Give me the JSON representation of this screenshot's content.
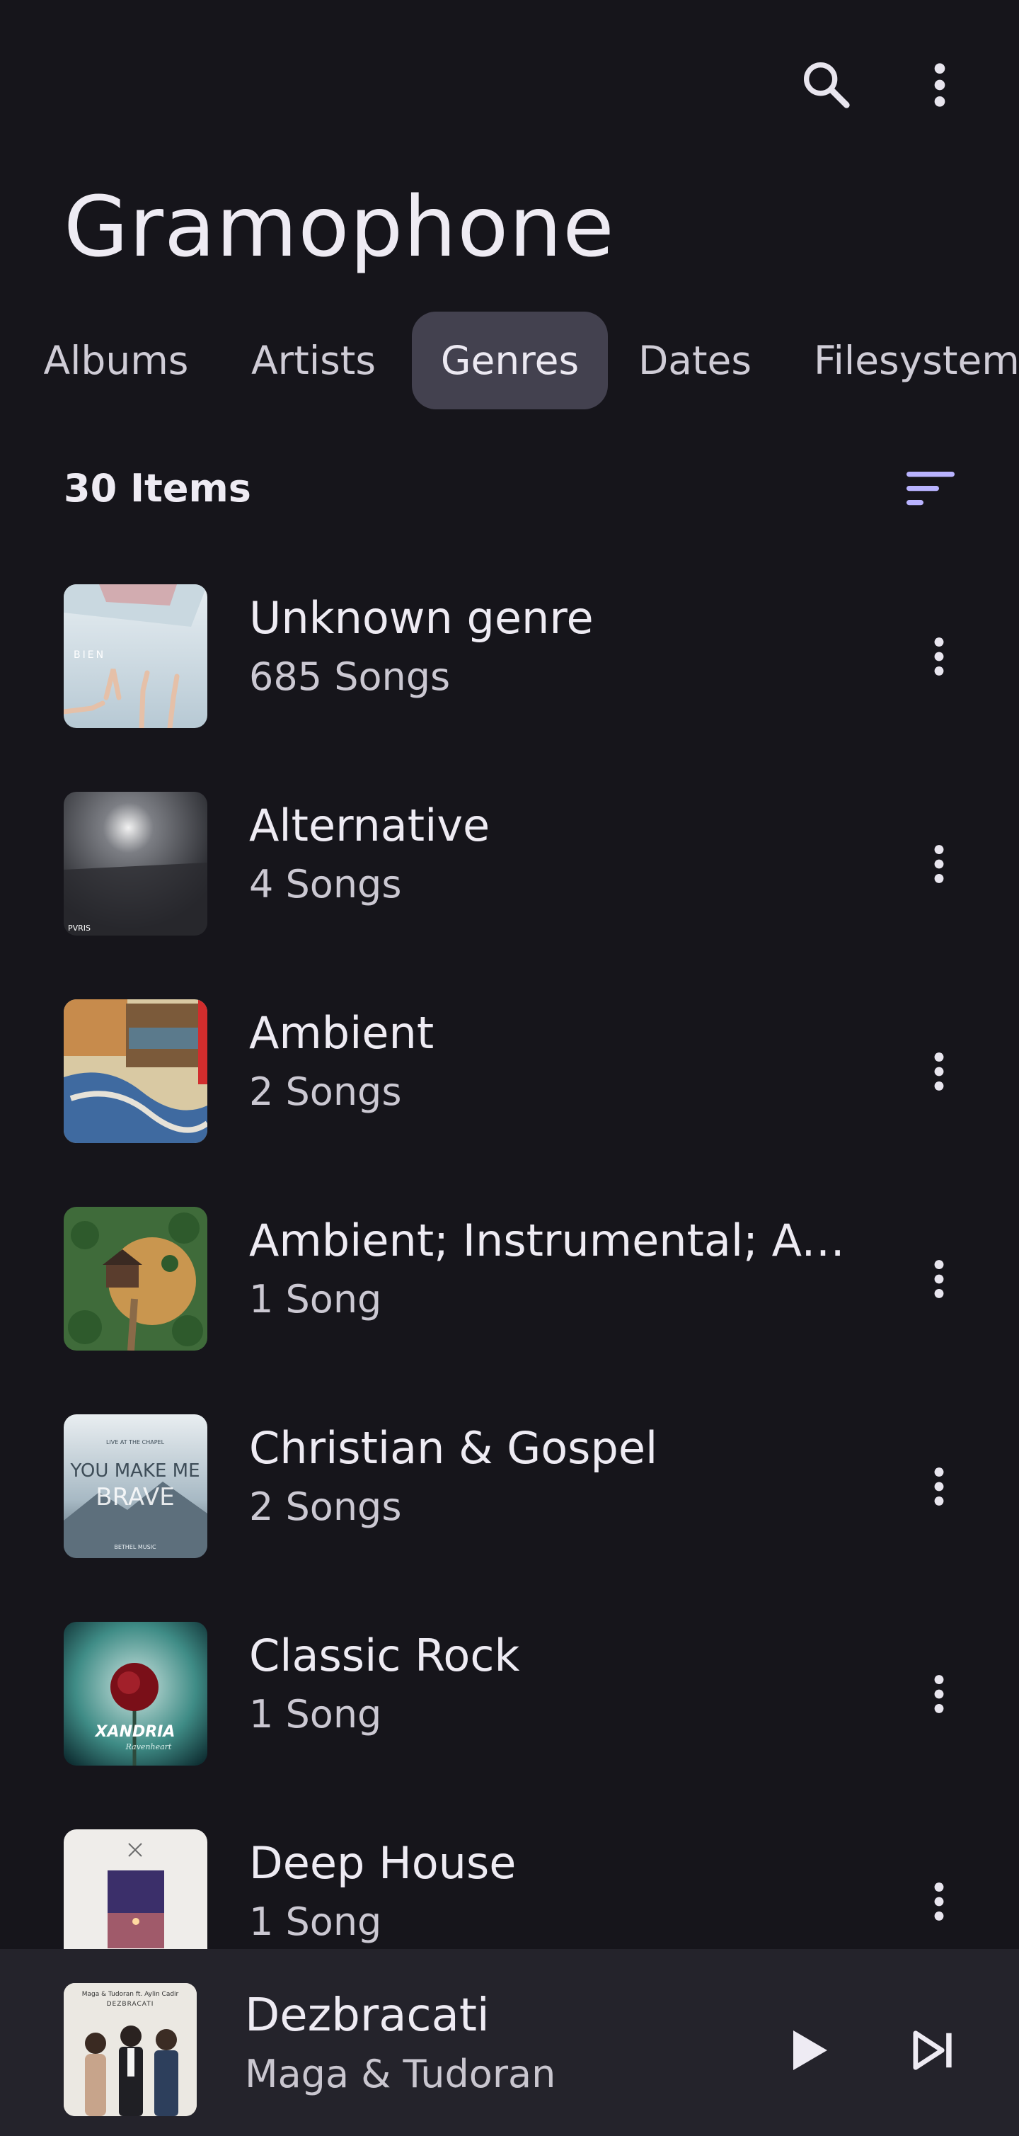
{
  "app": {
    "title": "Gramophone",
    "colors": {
      "background": "#16151b",
      "active_tab": "#43414f",
      "accent": "#b9b3ff",
      "player_bg": "#24232b"
    }
  },
  "topbar": {
    "search_icon": "search-icon",
    "more_icon": "more-vert-icon"
  },
  "tabs": [
    {
      "label": "Albums",
      "active": false
    },
    {
      "label": "Artists",
      "active": false
    },
    {
      "label": "Genres",
      "active": true
    },
    {
      "label": "Dates",
      "active": false
    },
    {
      "label": "Filesystem",
      "active": false
    }
  ],
  "list": {
    "count_label": "30 Items",
    "sort_icon": "sort-icon",
    "genres": [
      {
        "name": "Unknown genre",
        "subtitle": "685 Songs"
      },
      {
        "name": "Alternative",
        "subtitle": "4 Songs"
      },
      {
        "name": "Ambient",
        "subtitle": "2 Songs"
      },
      {
        "name": "Ambient; Instrumental; Ac⋯",
        "subtitle": "1 Song"
      },
      {
        "name": "Christian & Gospel",
        "subtitle": "2 Songs"
      },
      {
        "name": "Classic Rock",
        "subtitle": "1 Song"
      },
      {
        "name": "Deep House",
        "subtitle": "1 Song"
      }
    ]
  },
  "art_text": {
    "art0": "BIEN",
    "art1": "PVRIS",
    "art4_top": "LIVE AT THE CHAPEL",
    "art4_line1": "YOU MAKE ME",
    "art4_line2": "BRAVE",
    "art4_footer": "BETHEL MUSIC",
    "art5": "XANDRIA",
    "art5_sub": "Ravenheart",
    "player_art_line1": "Maga & Tudoran ft. Aylin Cadir",
    "player_art_line2": "DEZBRACATI"
  },
  "player": {
    "title": "Dezbracati",
    "artist": "Maga & Tudoran",
    "play_icon": "play-icon",
    "next_icon": "skip-next-icon"
  }
}
